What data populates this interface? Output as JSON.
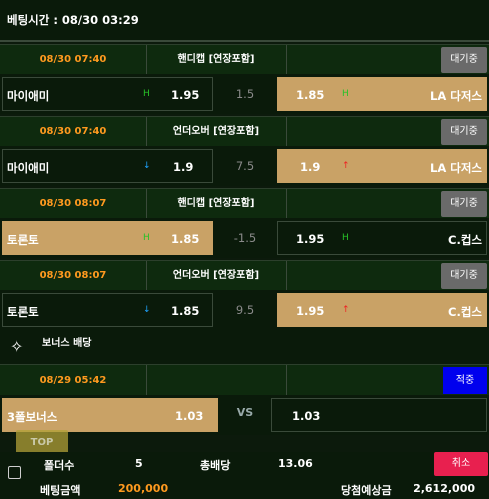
{
  "title": "베팅시간 : 08/30 03:29",
  "markets": [
    {
      "time": "08/30 07:40",
      "market": "핸디캡 [연장포함]",
      "status": "대기중",
      "home": "마이애미",
      "home_odds": "1.95",
      "home_icon": "H",
      "base": "1.5",
      "away_odds": "1.85",
      "away_icon": "H",
      "away": "LA 다저스"
    },
    {
      "time": "08/30 07:40",
      "market": "언더오버 [연장포함]",
      "status": "대기중",
      "home": "마이애미",
      "home_odds": "1.9",
      "home_icon": "↓",
      "base": "7.5",
      "away_odds": "1.9",
      "away_icon": "↑",
      "away": "LA 다저스"
    },
    {
      "time": "08/30 08:07",
      "market": "핸디캡 [연장포함]",
      "status": "대기중",
      "home": "토론토",
      "home_odds": "1.85",
      "home_icon": "H",
      "base": "-1.5",
      "away_odds": "1.95",
      "away_icon": "H",
      "away": "C.컵스"
    },
    {
      "time": "08/30 08:07",
      "market": "언더오버 [연장포함]",
      "status": "대기중",
      "home": "토론토",
      "home_odds": "1.85",
      "home_icon": "↓",
      "base": "9.5",
      "away_odds": "1.95",
      "away_icon": "↑",
      "away": "C.컵스"
    }
  ],
  "bonus": {
    "label": "보너스 배당",
    "time": "08/29 05:42",
    "status": "적중",
    "name": "3폴보너스",
    "odds": "1.03",
    "vs": "VS",
    "away_odds": "1.03"
  },
  "top_label": "TOP",
  "summary": {
    "folder_label": "폴더수",
    "folder_value": "5",
    "total_label": "총배당",
    "total_value": "13.06",
    "cancel": "취소",
    "amount_label": "베팅금액",
    "amount_value": "200,000",
    "expected_label": "당첨예상금",
    "expected_value": "2,612,000"
  }
}
